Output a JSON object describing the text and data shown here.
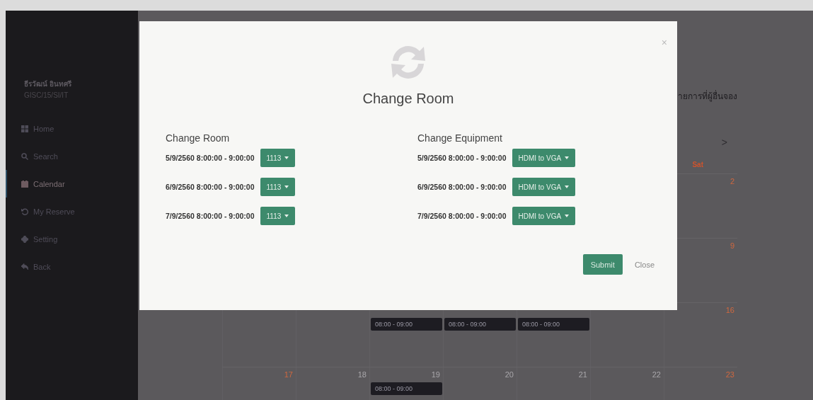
{
  "sidebar": {
    "user_name": "ธีรวัฒน์ อินทศรี",
    "user_id": "GISC/15/SI/IT",
    "items": [
      {
        "kind": "home",
        "label": "Home",
        "selected": false
      },
      {
        "kind": "search",
        "label": "Search",
        "selected": false
      },
      {
        "kind": "calendar",
        "label": "Calendar",
        "selected": true
      },
      {
        "kind": "history",
        "label": "My Reserve",
        "selected": false
      },
      {
        "kind": "setting",
        "label": "Setting",
        "selected": false
      },
      {
        "kind": "back",
        "label": "Back",
        "selected": false
      }
    ]
  },
  "calendar": {
    "title": "ายการที่ผู้อื่นจอง",
    "next_button": ">",
    "saturday_header": "Sat",
    "weeks": [
      {
        "days": [
          {
            "kind": "sat",
            "day": "2"
          }
        ]
      },
      {
        "days": [
          {
            "kind": "sat",
            "day": "9"
          }
        ]
      },
      {
        "days": [
          {
            "kind": "tue",
            "events": [
              "08:00 - 09:00"
            ]
          },
          {
            "kind": "wed",
            "events": [
              "08:00 - 09:00"
            ]
          },
          {
            "kind": "thu",
            "events": [
              "08:00 - 09:00"
            ]
          },
          {
            "kind": "sat",
            "day": "16"
          }
        ]
      },
      {
        "days": [
          {
            "kind": "sun",
            "day": "17"
          },
          {
            "kind": "mon",
            "day": "18"
          },
          {
            "kind": "tue",
            "day": "19",
            "events": [
              "08:00 - 09:00"
            ]
          },
          {
            "kind": "wed",
            "day": "20"
          },
          {
            "kind": "thu",
            "day": "21"
          },
          {
            "kind": "fri",
            "day": "22"
          },
          {
            "kind": "sat",
            "day": "23"
          }
        ]
      }
    ]
  },
  "modal": {
    "title": "Change Room",
    "close_button": "×",
    "sections": [
      {
        "heading": "Change Room",
        "rows": [
          {
            "time": "5/9/2560 8:00:00 - 9:00:00",
            "choice": "1113"
          },
          {
            "time": "6/9/2560 8:00:00 - 9:00:00",
            "choice": "1113"
          },
          {
            "time": "7/9/2560 8:00:00 - 9:00:00",
            "choice": "1113"
          }
        ]
      },
      {
        "heading": "Change Equipment",
        "rows": [
          {
            "time": "5/9/2560 8:00:00 - 9:00:00",
            "choice": "HDMI to VGA"
          },
          {
            "time": "6/9/2560 8:00:00 - 9:00:00",
            "choice": "HDMI to VGA"
          },
          {
            "time": "7/9/2560 8:00:00 - 9:00:00",
            "choice": "HDMI to VGA"
          }
        ]
      }
    ],
    "buttons": [
      {
        "kind": "primary",
        "label": "Submit"
      },
      {
        "kind": "plain",
        "label": "Close"
      }
    ]
  }
}
